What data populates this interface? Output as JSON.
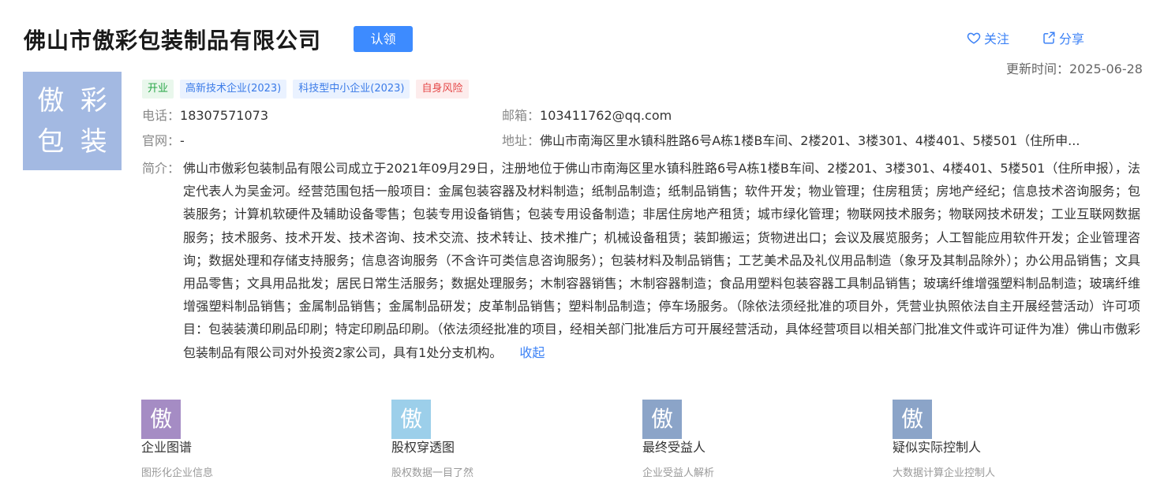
{
  "company": {
    "name": "佛山市傲彩包装制品有限公司",
    "claim_label": "认领",
    "logo_chars": [
      "傲",
      "彩",
      "包",
      "装"
    ]
  },
  "actions": {
    "follow_label": "关注",
    "share_label": "分享"
  },
  "updated": "更新时间：2025-06-28",
  "tags": [
    {
      "label": "开业",
      "color": "#25a544"
    },
    {
      "label": "高新技术企业(2023)",
      "color": "#3b7be8"
    },
    {
      "label": "科技型中小企业(2023)",
      "color": "#3b7be8"
    },
    {
      "label": "自身风险",
      "color": "#e54848"
    }
  ],
  "fields": {
    "phone_label": "电话：",
    "phone": "18307571073",
    "email_label": "邮箱：",
    "email": "103411762@qq.com",
    "website_label": "官网：",
    "website": "-",
    "address_label": "地址：",
    "address": "佛山市南海区里水镇科胜路6号A栋1楼B车间、2楼201、3楼301、4楼401、5楼501（住所申..."
  },
  "intro": {
    "label": "简介：",
    "text": "佛山市傲彩包装制品有限公司成立于2021年09月29日，注册地位于佛山市南海区里水镇科胜路6号A栋1楼B车间、2楼201、3楼301、4楼401、5楼501（住所申报），法定代表人为吴金河。经营范围包括一般项目：金属包装容器及材料制造；纸制品制造；纸制品销售；软件开发；物业管理；住房租赁；房地产经纪；信息技术咨询服务；包装服务；计算机软硬件及辅助设备零售；包装专用设备销售；包装专用设备制造；非居住房地产租赁；城市绿化管理；物联网技术服务；物联网技术研发；工业互联网数据服务；技术服务、技术开发、技术咨询、技术交流、技术转让、技术推广；机械设备租赁；装卸搬运；货物进出口；会议及展览服务；人工智能应用软件开发；企业管理咨询；数据处理和存储支持服务；信息咨询服务（不含许可类信息咨询服务）；包装材料及制品销售；工艺美术品及礼仪用品制造（象牙及其制品除外）；办公用品销售；文具用品零售；文具用品批发；居民日常生活服务；数据处理服务；木制容器销售；木制容器制造；食品用塑料包装容器工具制品销售；玻璃纤维增强塑料制品制造；玻璃纤维增强塑料制品销售；金属制品销售；金属制品研发；皮革制品销售；塑料制品制造；停车场服务。（除依法须经批准的项目外，凭营业执照依法自主开展经营活动）许可项目：包装装潢印刷品印刷；特定印刷品印刷。（依法须经批准的项目，经相关部门批准后方可开展经营活动，具体经营项目以相关部门批准文件或许可证件为准）佛山市傲彩包装制品有限公司对外投资2家公司，具有1处分支机构。",
    "collapse_label": "收起"
  },
  "cards": [
    {
      "icon_char": "傲",
      "icon_color": "#a58cc4",
      "title": "企业图谱",
      "subtitle": "图形化企业信息"
    },
    {
      "icon_char": "傲",
      "icon_color": "#9ccfea",
      "title": "股权穿透图",
      "subtitle": "股权数据一目了然"
    },
    {
      "icon_char": "傲",
      "icon_color": "#8ba4c8",
      "title": "最终受益人",
      "subtitle": "企业受益人解析"
    },
    {
      "icon_char": "傲",
      "icon_color": "#8ba4c8",
      "title": "疑似实际控制人",
      "subtitle": "大数据计算企业控制人"
    }
  ]
}
